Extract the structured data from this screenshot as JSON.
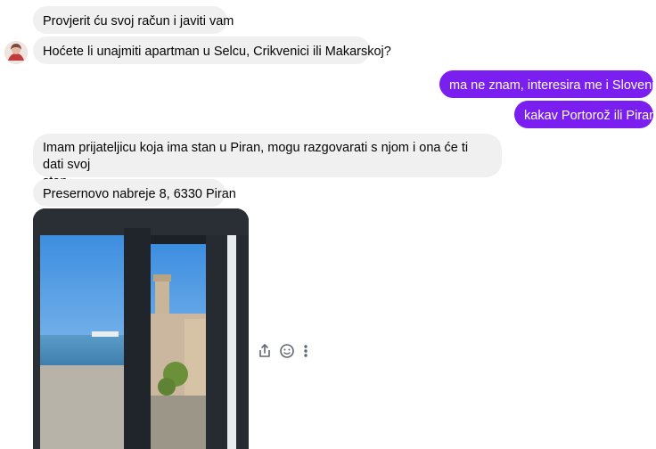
{
  "messages": [
    {
      "id": "m1",
      "text": "Provjerit ću svoj račun i javiti vam"
    },
    {
      "id": "m2",
      "text": "Hoćete li unajmiti apartman u Selcu, Crikvenici ili Makarskoj?"
    },
    {
      "id": "m3",
      "text": "ma ne znam, interesira me i Slovenija"
    },
    {
      "id": "m4",
      "text": "kakav Portorož ili Piran"
    },
    {
      "id": "m5_line1",
      "text": "Imam prijateljicu koja ima stan u Piran, mogu razgovarati s njom i ona će ti dati svoj"
    },
    {
      "id": "m5_line2",
      "text": "stan."
    },
    {
      "id": "m6",
      "text": "Presernovo nabreje 8, 6330 Piran"
    }
  ],
  "colors": {
    "incoming_bubble": "#f0f0f0",
    "outgoing_bubble": "#7a1ff0"
  },
  "icons": {
    "share": "share-icon",
    "react": "smiley-icon",
    "more": "more-vertical-icon"
  }
}
